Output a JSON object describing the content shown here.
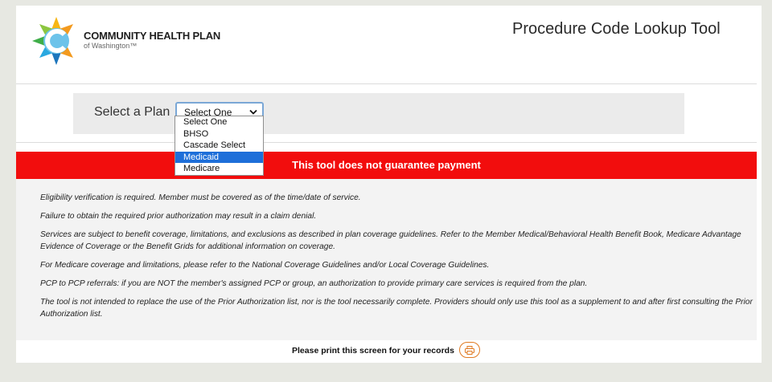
{
  "header": {
    "logo": {
      "line1": "COMMUNITY HEALTH PLAN",
      "line2": "of Washington™"
    },
    "tool_title": "Procedure Code Lookup Tool"
  },
  "plan_selector": {
    "label": "Select a Plan",
    "selected_value": "Select One",
    "options": [
      "Select One",
      "BHSO",
      "Cascade Select",
      "Medicaid",
      "Medicare"
    ],
    "highlighted_option": "Medicaid"
  },
  "banner": {
    "text": "This tool does not guarantee payment",
    "color": "#f20d0d"
  },
  "notes": [
    "Eligibility verification is required. Member must be covered as of the time/date of service.",
    "Failure to obtain the required prior authorization may result in a claim denial.",
    "Services are subject to benefit coverage, limitations, and exclusions as described in plan coverage guidelines. Refer to the Member Medical/Behavioral Health Benefit Book, Medicare Advantage Evidence of Coverage or the Benefit Grids for additional information on coverage.",
    "For Medicare coverage and limitations, please refer to the National Coverage Guidelines and/or Local Coverage Guidelines.",
    "PCP to PCP referrals: if you are NOT the member's assigned PCP or group, an authorization to provide primary care services is required from the plan.",
    "The tool is not intended to replace the use of the Prior Authorization list, nor is the tool necessarily complete. Providers should only use this tool as a supplement to and after first consulting the Prior Authorization list."
  ],
  "footer": {
    "print_text": "Please print this screen for your records",
    "print_icon": "printer-icon",
    "accent": "#e07a22"
  },
  "colors": {
    "background": "#e7e8e2",
    "selection": "#1e6fd9"
  }
}
